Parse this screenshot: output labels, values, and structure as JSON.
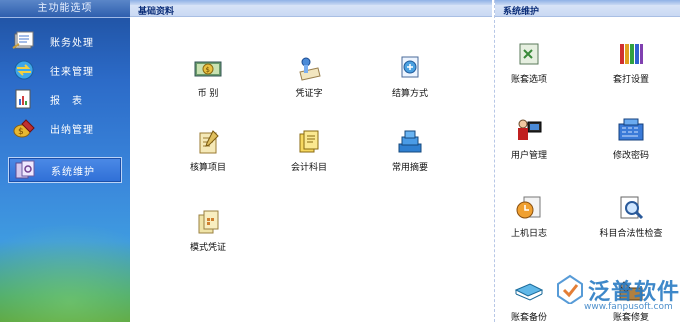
{
  "sidebar": {
    "title": "主功能选项",
    "items": [
      {
        "label": "账务处理",
        "icon": "ledger-icon"
      },
      {
        "label": "往来管理",
        "icon": "exchange-icon"
      },
      {
        "label": "报　表",
        "icon": "report-icon"
      },
      {
        "label": "出纳管理",
        "icon": "cashier-icon"
      },
      {
        "label": "系统维护",
        "icon": "maintenance-icon",
        "active": true
      }
    ]
  },
  "basic": {
    "title": "基础资料",
    "items": [
      {
        "label": "币 别",
        "icon": "currency-icon"
      },
      {
        "label": "凭证字",
        "icon": "voucher-word-icon"
      },
      {
        "label": "结算方式",
        "icon": "settlement-icon"
      },
      {
        "label": "核算项目",
        "icon": "accounting-item-icon"
      },
      {
        "label": "会计科目",
        "icon": "account-subject-icon"
      },
      {
        "label": "常用摘要",
        "icon": "common-summary-icon"
      },
      {
        "label": "模式凭证",
        "icon": "template-voucher-icon"
      }
    ]
  },
  "system": {
    "title": "系统维护",
    "items": [
      {
        "label": "账套选项",
        "icon": "account-options-icon"
      },
      {
        "label": "套打设置",
        "icon": "print-settings-icon"
      },
      {
        "label": "用户管理",
        "icon": "user-management-icon"
      },
      {
        "label": "修改密码",
        "icon": "change-password-icon"
      },
      {
        "label": "上机日志",
        "icon": "log-icon"
      },
      {
        "label": "科目合法性检查",
        "icon": "subject-check-icon"
      },
      {
        "label": "账套备份",
        "icon": "backup-icon"
      },
      {
        "label": "账套修复",
        "icon": "repair-icon"
      }
    ]
  },
  "watermark": {
    "brand": "泛普软件",
    "url": "www.fanpusoft.com"
  }
}
